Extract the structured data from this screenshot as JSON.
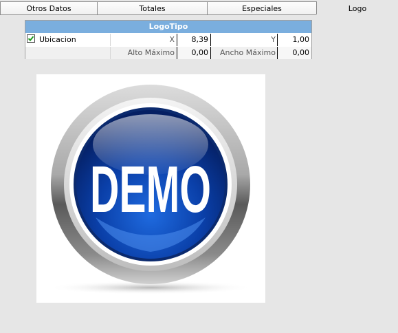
{
  "tabs": [
    {
      "label": "Otros Datos"
    },
    {
      "label": "Totales"
    },
    {
      "label": "Especiales"
    },
    {
      "label": "Logo"
    }
  ],
  "grid": {
    "title": "LogoTipo",
    "row1": {
      "checkbox_label": "Ubicacion",
      "checked": true,
      "x_label": "X",
      "x_value": "8,39",
      "y_label": "Y",
      "y_value": "1,00"
    },
    "row2": {
      "alto_label": "Alto Máximo",
      "alto_value": "0,00",
      "ancho_label": "Ancho Máximo",
      "ancho_value": "0,00"
    }
  },
  "logo": {
    "text": "DEMO",
    "colors": {
      "button_blue": "#0a3fa8",
      "ring_gray": "#9a9a9a"
    }
  },
  "colors": {
    "header_blue": "#7aaede",
    "check_green": "#1f9a1f",
    "background": "#e6e6e6"
  }
}
